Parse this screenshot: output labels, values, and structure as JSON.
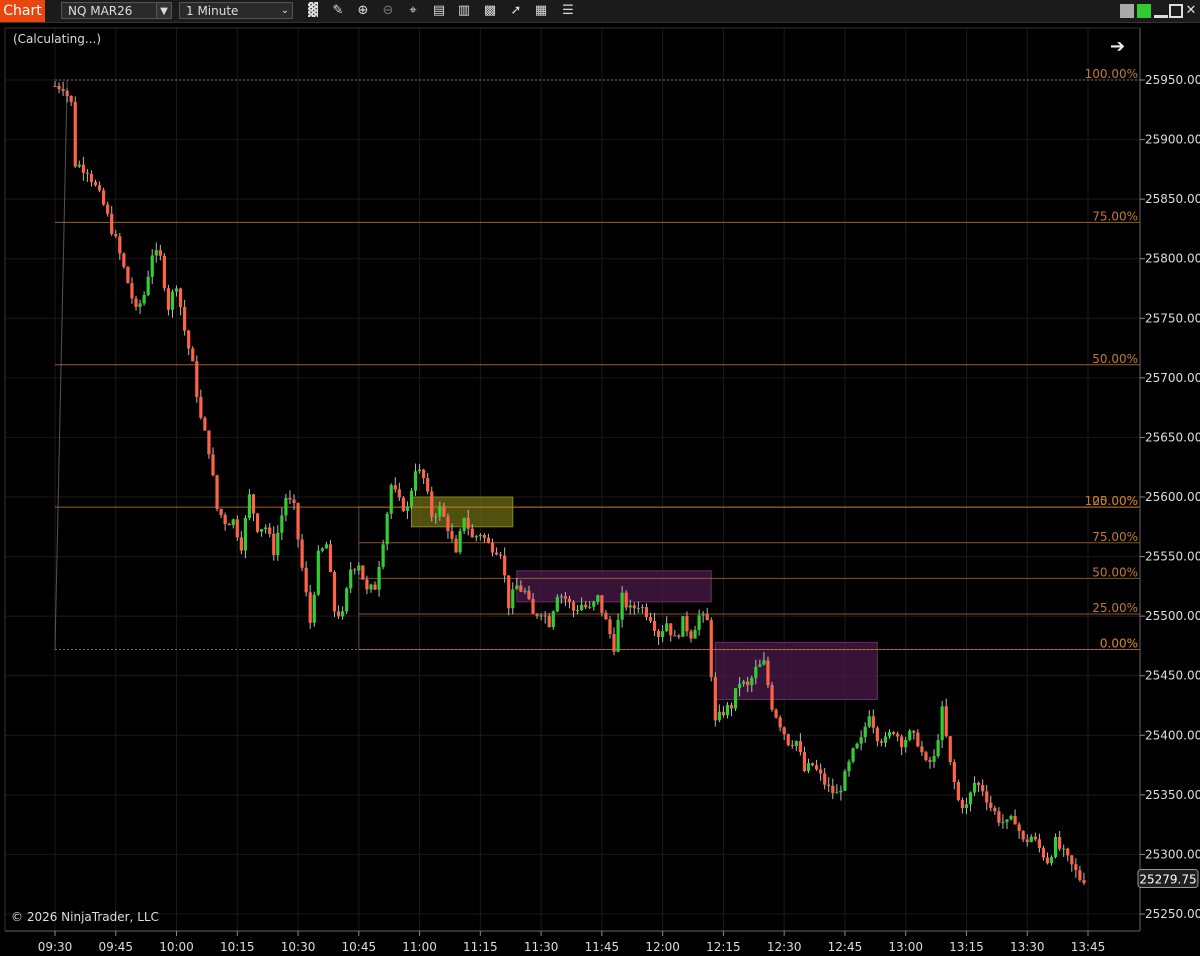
{
  "toolbar": {
    "tab_label": "Chart",
    "instrument": "NQ MAR26",
    "interval": "1 Minute",
    "tools": [
      "bar-type-icon",
      "draw-pencil-icon",
      "zoom-in-icon",
      "zoom-out-icon",
      "crosshair-icon",
      "data-box-icon",
      "templates-icon",
      "strategies-icon",
      "indicators-icon",
      "properties-icon",
      "more-icon"
    ]
  },
  "status": {
    "calculating": "(Calculating...)"
  },
  "footer": {
    "copyright": "© 2026 NinjaTrader, LLC"
  },
  "colors": {
    "up": "#32cd32",
    "down": "#ff6347",
    "fib": "#c07a30",
    "grid": "#1a1a1a",
    "box_yellow": "#6b6b14",
    "box_purple": "#4a1a4a"
  },
  "chart_data": {
    "type": "candlestick",
    "ylim": [
      25235,
      25985
    ],
    "x_ticks": [
      "09:30",
      "09:45",
      "10:00",
      "10:15",
      "10:30",
      "10:45",
      "11:00",
      "11:15",
      "11:30",
      "11:45",
      "12:00",
      "12:15",
      "12:30",
      "12:45",
      "13:00",
      "13:15",
      "13:30",
      "13:45"
    ],
    "y_ticks": [
      "25950.00",
      "25900.00",
      "25850.00",
      "25800.00",
      "25750.00",
      "25700.00",
      "25650.00",
      "25600.00",
      "25550.00",
      "25500.00",
      "25450.00",
      "25400.00",
      "25350.00",
      "25300.00",
      "25250.00"
    ],
    "last_price": "25279.75",
    "fib_levels": [
      {
        "label": "100.00%",
        "price": 25950.0
      },
      {
        "label": "75.00%",
        "price": 25830.5
      },
      {
        "label": "50.00%",
        "price": 25711.0
      },
      {
        "label": "25.00%",
        "price": 25591.5
      },
      {
        "label": "0.00%",
        "price": 25472.0
      }
    ],
    "fib_levels_2": [
      {
        "label": "100.00%",
        "price": 25591.5
      },
      {
        "label": "75.00%",
        "price": 25561.6
      },
      {
        "label": "50.00%",
        "price": 25531.7
      },
      {
        "label": "25.00%",
        "price": 25501.8
      },
      {
        "label": "0.00%",
        "price": 25472.0
      }
    ],
    "zones": [
      {
        "color": "yellow",
        "t_start": "10:58",
        "t_end": "11:23",
        "high": 25600,
        "low": 25575
      },
      {
        "color": "purple",
        "t_start": "11:24",
        "t_end": "12:12",
        "high": 25538,
        "low": 25512
      },
      {
        "color": "purple",
        "t_start": "12:13",
        "t_end": "12:53",
        "high": 25478,
        "low": 25430
      }
    ],
    "path": [
      [
        "09:30",
        25945
      ],
      [
        "09:33",
        25945
      ],
      [
        "09:35",
        25930
      ],
      [
        "09:36",
        25880
      ],
      [
        "09:39",
        25875
      ],
      [
        "09:41",
        25860
      ],
      [
        "09:43",
        25845
      ],
      [
        "09:46",
        25815
      ],
      [
        "09:49",
        25780
      ],
      [
        "09:51",
        25755
      ],
      [
        "09:53",
        25770
      ],
      [
        "09:55",
        25805
      ],
      [
        "09:57",
        25800
      ],
      [
        "09:59",
        25760
      ],
      [
        "10:01",
        25780
      ],
      [
        "10:03",
        25740
      ],
      [
        "10:05",
        25710
      ],
      [
        "10:07",
        25665
      ],
      [
        "10:09",
        25640
      ],
      [
        "10:11",
        25590
      ],
      [
        "10:13",
        25580
      ],
      [
        "10:15",
        25580
      ],
      [
        "10:17",
        25560
      ],
      [
        "10:19",
        25600
      ],
      [
        "10:21",
        25575
      ],
      [
        "10:23",
        25575
      ],
      [
        "10:25",
        25555
      ],
      [
        "10:28",
        25600
      ],
      [
        "10:30",
        25590
      ],
      [
        "10:32",
        25540
      ],
      [
        "10:34",
        25495
      ],
      [
        "10:36",
        25550
      ],
      [
        "10:38",
        25560
      ],
      [
        "10:40",
        25505
      ],
      [
        "10:42",
        25500
      ],
      [
        "10:44",
        25540
      ],
      [
        "10:46",
        25545
      ],
      [
        "10:48",
        25520
      ],
      [
        "10:50",
        25525
      ],
      [
        "10:52",
        25565
      ],
      [
        "10:54",
        25610
      ],
      [
        "10:56",
        25595
      ],
      [
        "10:58",
        25590
      ],
      [
        "11:00",
        25625
      ],
      [
        "11:02",
        25615
      ],
      [
        "11:04",
        25585
      ],
      [
        "11:06",
        25590
      ],
      [
        "11:08",
        25575
      ],
      [
        "11:10",
        25550
      ],
      [
        "11:12",
        25585
      ],
      [
        "11:14",
        25565
      ],
      [
        "11:16",
        25570
      ],
      [
        "11:18",
        25560
      ],
      [
        "11:21",
        25555
      ],
      [
        "11:23",
        25510
      ],
      [
        "11:25",
        25525
      ],
      [
        "11:27",
        25520
      ],
      [
        "11:29",
        25500
      ],
      [
        "11:31",
        25505
      ],
      [
        "11:33",
        25495
      ],
      [
        "11:35",
        25520
      ],
      [
        "11:37",
        25515
      ],
      [
        "11:39",
        25505
      ],
      [
        "11:41",
        25510
      ],
      [
        "11:43",
        25505
      ],
      [
        "11:45",
        25515
      ],
      [
        "11:47",
        25495
      ],
      [
        "11:49",
        25475
      ],
      [
        "11:51",
        25515
      ],
      [
        "11:53",
        25505
      ],
      [
        "11:55",
        25510
      ],
      [
        "11:58",
        25500
      ],
      [
        "12:00",
        25485
      ],
      [
        "12:02",
        25495
      ],
      [
        "12:04",
        25480
      ],
      [
        "12:06",
        25495
      ],
      [
        "12:08",
        25485
      ],
      [
        "12:10",
        25500
      ],
      [
        "12:12",
        25495
      ],
      [
        "12:14",
        25410
      ],
      [
        "12:16",
        25420
      ],
      [
        "12:18",
        25425
      ],
      [
        "12:20",
        25445
      ],
      [
        "12:22",
        25440
      ],
      [
        "12:24",
        25455
      ],
      [
        "12:26",
        25460
      ],
      [
        "12:28",
        25425
      ],
      [
        "12:30",
        25410
      ],
      [
        "12:32",
        25395
      ],
      [
        "12:34",
        25395
      ],
      [
        "12:36",
        25370
      ],
      [
        "12:38",
        25375
      ],
      [
        "12:40",
        25365
      ],
      [
        "12:42",
        25355
      ],
      [
        "12:44",
        25350
      ],
      [
        "12:46",
        25365
      ],
      [
        "12:48",
        25385
      ],
      [
        "12:50",
        25395
      ],
      [
        "12:52",
        25420
      ],
      [
        "12:54",
        25400
      ],
      [
        "12:56",
        25395
      ],
      [
        "12:58",
        25405
      ],
      [
        "13:00",
        25395
      ],
      [
        "13:02",
        25400
      ],
      [
        "13:04",
        25395
      ],
      [
        "13:06",
        25375
      ],
      [
        "13:08",
        25380
      ],
      [
        "13:10",
        25420
      ],
      [
        "13:12",
        25375
      ],
      [
        "13:14",
        25345
      ],
      [
        "13:16",
        25340
      ],
      [
        "13:18",
        25360
      ],
      [
        "13:20",
        25355
      ],
      [
        "13:22",
        25340
      ],
      [
        "13:24",
        25330
      ],
      [
        "13:26",
        25325
      ],
      [
        "13:28",
        25330
      ],
      [
        "13:30",
        25310
      ],
      [
        "13:32",
        25315
      ],
      [
        "13:34",
        25305
      ],
      [
        "13:36",
        25295
      ],
      [
        "13:38",
        25310
      ],
      [
        "13:40",
        25300
      ],
      [
        "13:42",
        25290
      ],
      [
        "13:44",
        25280
      ]
    ]
  }
}
